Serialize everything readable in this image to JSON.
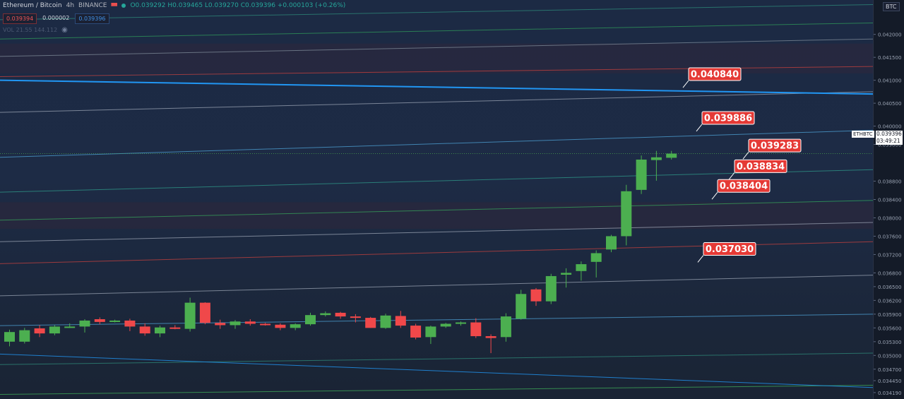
{
  "header": {
    "pair": "Ethereum / Bitcoin",
    "interval": "4h",
    "exchange": "BINANCE",
    "ohlc_text": "O0.039292 H0.039465 L0.039270 C0.039396 +0.000103 (+0.26%)",
    "bid": "0.039394",
    "spread": "0.000002",
    "ask": "0.039396",
    "indicator_text": "VOL 21.55 144.112",
    "currency": "BTC"
  },
  "last_price": {
    "symbol": "ETHBTC",
    "value": "0.039396",
    "countdown": "03:49:21"
  },
  "colors": {
    "up": "#4caf50",
    "down": "#f0484a",
    "label_bg": "#e53935",
    "trendline": "#2196f3"
  },
  "chart_data": {
    "type": "candlestick",
    "ylim": [
      0.03405,
      0.04275
    ],
    "y_ticks": [
      "0.042000",
      "0.041500",
      "0.041000",
      "0.040500",
      "0.040000",
      "0.039600",
      "0.038800",
      "0.038400",
      "0.038000",
      "0.037600",
      "0.037200",
      "0.036800",
      "0.036500",
      "0.036200",
      "0.035900",
      "0.035600",
      "0.035300",
      "0.035000",
      "0.034700",
      "0.034450",
      "0.034190"
    ],
    "levels": [
      {
        "label": "0.040840",
        "value": 0.04084
      },
      {
        "label": "0.039886",
        "value": 0.039886
      },
      {
        "label": "0.039283",
        "value": 0.039283
      },
      {
        "label": "0.038834",
        "value": 0.038834
      },
      {
        "label": "0.038404",
        "value": 0.038404
      },
      {
        "label": "0.037030",
        "value": 0.03703
      }
    ],
    "candles": [
      [
        0.0353,
        0.03556,
        0.0352,
        0.03551
      ],
      [
        0.0353,
        0.0356,
        0.03526,
        0.03555
      ],
      [
        0.03559,
        0.03566,
        0.0354,
        0.03548
      ],
      [
        0.03548,
        0.03566,
        0.03544,
        0.03563
      ],
      [
        0.03562,
        0.0357,
        0.0356,
        0.03563
      ],
      [
        0.03563,
        0.03579,
        0.0355,
        0.03576
      ],
      [
        0.03579,
        0.03583,
        0.03568,
        0.03573
      ],
      [
        0.03573,
        0.03578,
        0.03572,
        0.03576
      ],
      [
        0.03576,
        0.0358,
        0.03553,
        0.03563
      ],
      [
        0.03563,
        0.0357,
        0.03543,
        0.03548
      ],
      [
        0.03548,
        0.03565,
        0.0354,
        0.03561
      ],
      [
        0.03561,
        0.03566,
        0.03557,
        0.03558
      ],
      [
        0.03558,
        0.03626,
        0.03552,
        0.03615
      ],
      [
        0.03615,
        0.03616,
        0.03568,
        0.03571
      ],
      [
        0.03571,
        0.03578,
        0.03558,
        0.03566
      ],
      [
        0.03566,
        0.03577,
        0.03558,
        0.03574
      ],
      [
        0.03574,
        0.03579,
        0.03565,
        0.03569
      ],
      [
        0.03569,
        0.03571,
        0.03565,
        0.03567
      ],
      [
        0.03567,
        0.0357,
        0.03555,
        0.0356
      ],
      [
        0.0356,
        0.0357,
        0.03555,
        0.03568
      ],
      [
        0.03568,
        0.03593,
        0.03565,
        0.03588
      ],
      [
        0.03588,
        0.03596,
        0.03585,
        0.03592
      ],
      [
        0.03593,
        0.03595,
        0.0358,
        0.03585
      ],
      [
        0.03585,
        0.0359,
        0.03572,
        0.03582
      ],
      [
        0.03582,
        0.03584,
        0.0356,
        0.0356
      ],
      [
        0.0356,
        0.03591,
        0.03558,
        0.03587
      ],
      [
        0.03586,
        0.03597,
        0.0356,
        0.03565
      ],
      [
        0.03565,
        0.03569,
        0.03535,
        0.03539
      ],
      [
        0.0354,
        0.03565,
        0.03525,
        0.03563
      ],
      [
        0.03563,
        0.03571,
        0.0356,
        0.03569
      ],
      [
        0.03569,
        0.03574,
        0.03565,
        0.03572
      ],
      [
        0.03572,
        0.03581,
        0.03538,
        0.03542
      ],
      [
        0.03542,
        0.03546,
        0.03505,
        0.03538
      ],
      [
        0.0354,
        0.03592,
        0.0353,
        0.03585
      ],
      [
        0.0358,
        0.03643,
        0.03578,
        0.03634
      ],
      [
        0.03644,
        0.03647,
        0.03608,
        0.03618
      ],
      [
        0.03618,
        0.03678,
        0.03612,
        0.03673
      ],
      [
        0.03676,
        0.0369,
        0.03648,
        0.0368
      ],
      [
        0.03684,
        0.03705,
        0.03663,
        0.03699
      ],
      [
        0.03704,
        0.03729,
        0.0367,
        0.03723
      ],
      [
        0.03731,
        0.03763,
        0.03725,
        0.0376
      ],
      [
        0.0376,
        0.03872,
        0.0374,
        0.03858
      ],
      [
        0.03861,
        0.03936,
        0.03852,
        0.03927
      ],
      [
        0.03926,
        0.03946,
        0.03881,
        0.03932
      ],
      [
        0.03931,
        0.03946,
        0.03927,
        0.0394
      ]
    ]
  }
}
